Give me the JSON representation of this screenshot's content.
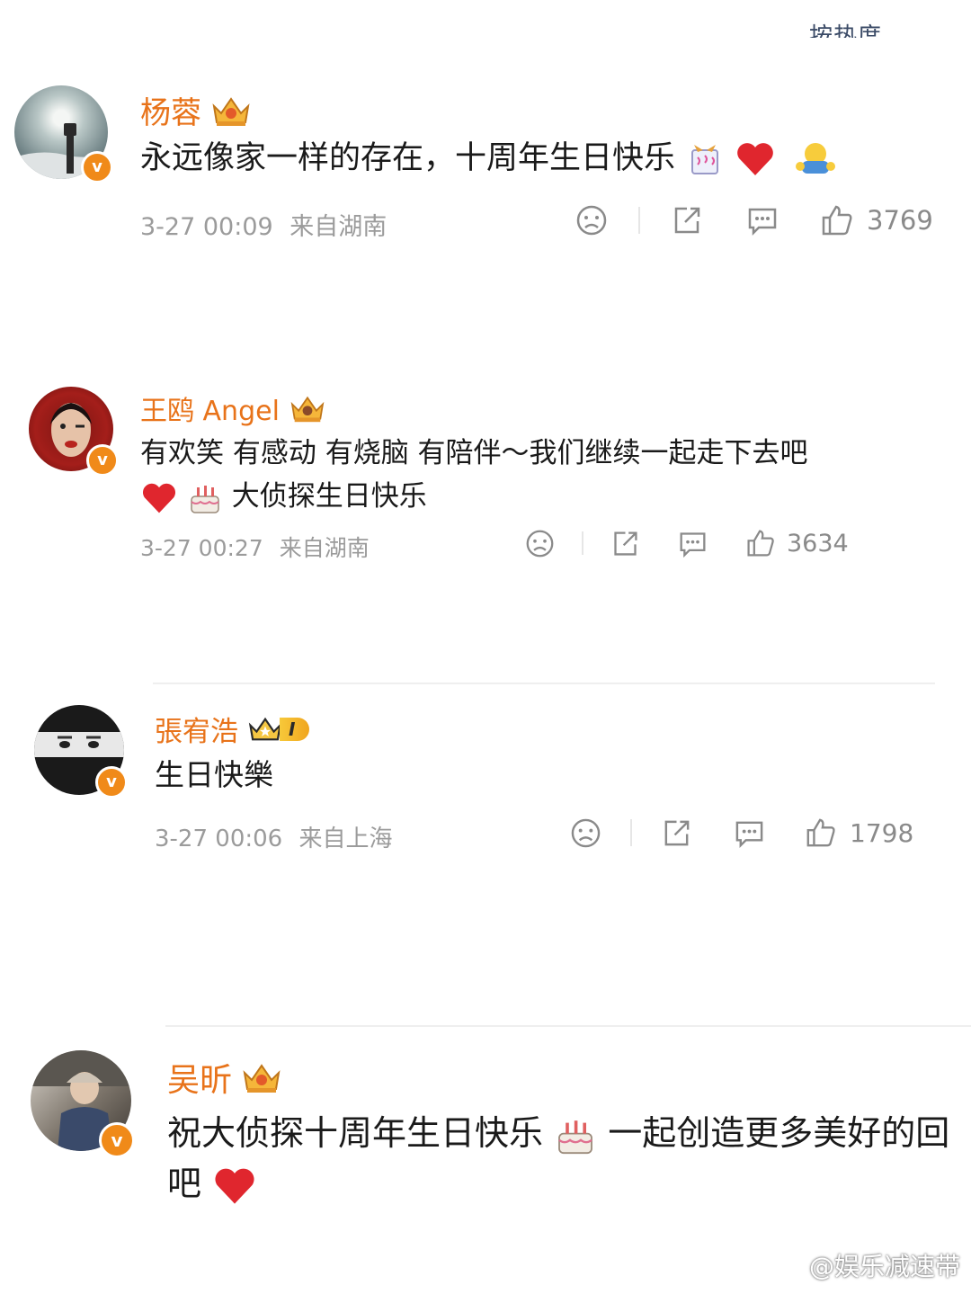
{
  "header": {
    "sort_label": "按热度"
  },
  "comments": [
    {
      "name": "杨蓉",
      "text_line1": "永远像家一样的存在，十周年生日快乐",
      "text_line2": "",
      "time": "3-27 00:09",
      "location": "来自湖南",
      "likes": "3769"
    },
    {
      "name": "王鸥 Angel",
      "text_line1": "有欢笑 有感动 有烧脑 有陪伴～我们继续一起走下去吧",
      "text_line2": "大侦探生日快乐",
      "time": "3-27 00:27",
      "location": "来自湖南",
      "likes": "3634"
    },
    {
      "name": "張宥浩",
      "level_badge": "I",
      "text_line1": "生日快樂",
      "text_line2": "",
      "time": "3-27 00:06",
      "location": "来自上海",
      "likes": "1798"
    },
    {
      "name": "吴昕",
      "text_line1": "祝大侦探十周年生日快乐",
      "text_line1b": "一起创造更多美好的回",
      "text_line2": "吧",
      "time": "",
      "location": "",
      "likes": ""
    }
  ],
  "icons": {
    "verified": "verified-v-icon",
    "crown": "crown-icon",
    "dislike": "sad-face-icon",
    "share": "share-icon",
    "reply": "comment-icon",
    "like": "thumbs-up-icon"
  },
  "colors": {
    "name": "#e8731a",
    "verified": "#f08a19",
    "meta": "#9b9b9b"
  },
  "watermark": {
    "text": "@娱乐减速带"
  }
}
